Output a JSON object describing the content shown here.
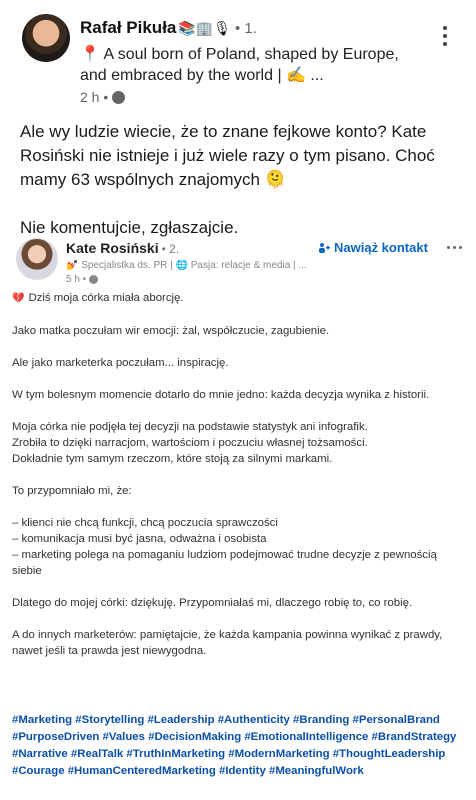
{
  "post": {
    "author": "Rafał Pikuła",
    "author_decorations": "📚🏢🎙",
    "degree": "• 1.",
    "headline": "📍 A soul born of Poland, shaped by Europe, and embraced by the world | ✍️ ...",
    "time": "2 h •",
    "paragraphs": [
      "Ale wy ludzie wiecie, że to znane fejkowe konto? Kate Rosiński nie istnieje i już wiele razy o tym pisano. Choć mamy 63 wspólnych znajomych 🫠",
      "Nie komentujcie, zgłaszajcie."
    ]
  },
  "shared": {
    "author": "Kate Rosiński",
    "degree": "• 2.",
    "subtitle": "💅 Specjalistka ds. PR | 🌐 Pasja: relacje & media | ...",
    "time": "5 h •",
    "connect_label": "Nawiąż kontakt",
    "first_line": "Dziś moja córka miała aborcję.",
    "blocks": [
      "Jako matka poczułam wir emocji: żal, współczucie, zagubienie.",
      "Ale jako marketerka poczułam... inspirację.",
      "W tym bolesnym momencie dotarło do mnie jedno: każda decyzja wynika z historii.",
      " Moja córka nie podjęła tej decyzji na podstawie statystyk ani infografik.\nZrobiła to dzięki narracjom, wartościom i poczuciu własnej tożsamości.\nDokładnie tym samym rzeczom, które stoją za silnymi markami.",
      "To przypomniało mi, że:",
      "– klienci nie chcą funkcji, chcą poczucia sprawczości\n– komunikacja musi być jasna, odważna i osobista\n– marketing polega na pomaganiu ludziom podejmować trudne decyzje z pewnością siebie",
      "Dlatego do mojej córki: dziękuję. Przypomniałaś mi, dlaczego robię to, co robię.",
      "A do innych marketerów: pamiętajcie, że każda kampania powinna wynikać z prawdy, nawet jeśli ta prawda jest niewygodna."
    ],
    "hashtags": "#Marketing #Storytelling #Leadership #Authenticity #Branding #PersonalBrand #PurposeDriven #Values #DecisionMaking #EmotionalIntelligence #BrandStrategy #Narrative #RealTalk #TruthInMarketing #ModernMarketing #ThoughtLeadership #Courage #HumanCenteredMarketing #Identity #MeaningfulWork"
  }
}
